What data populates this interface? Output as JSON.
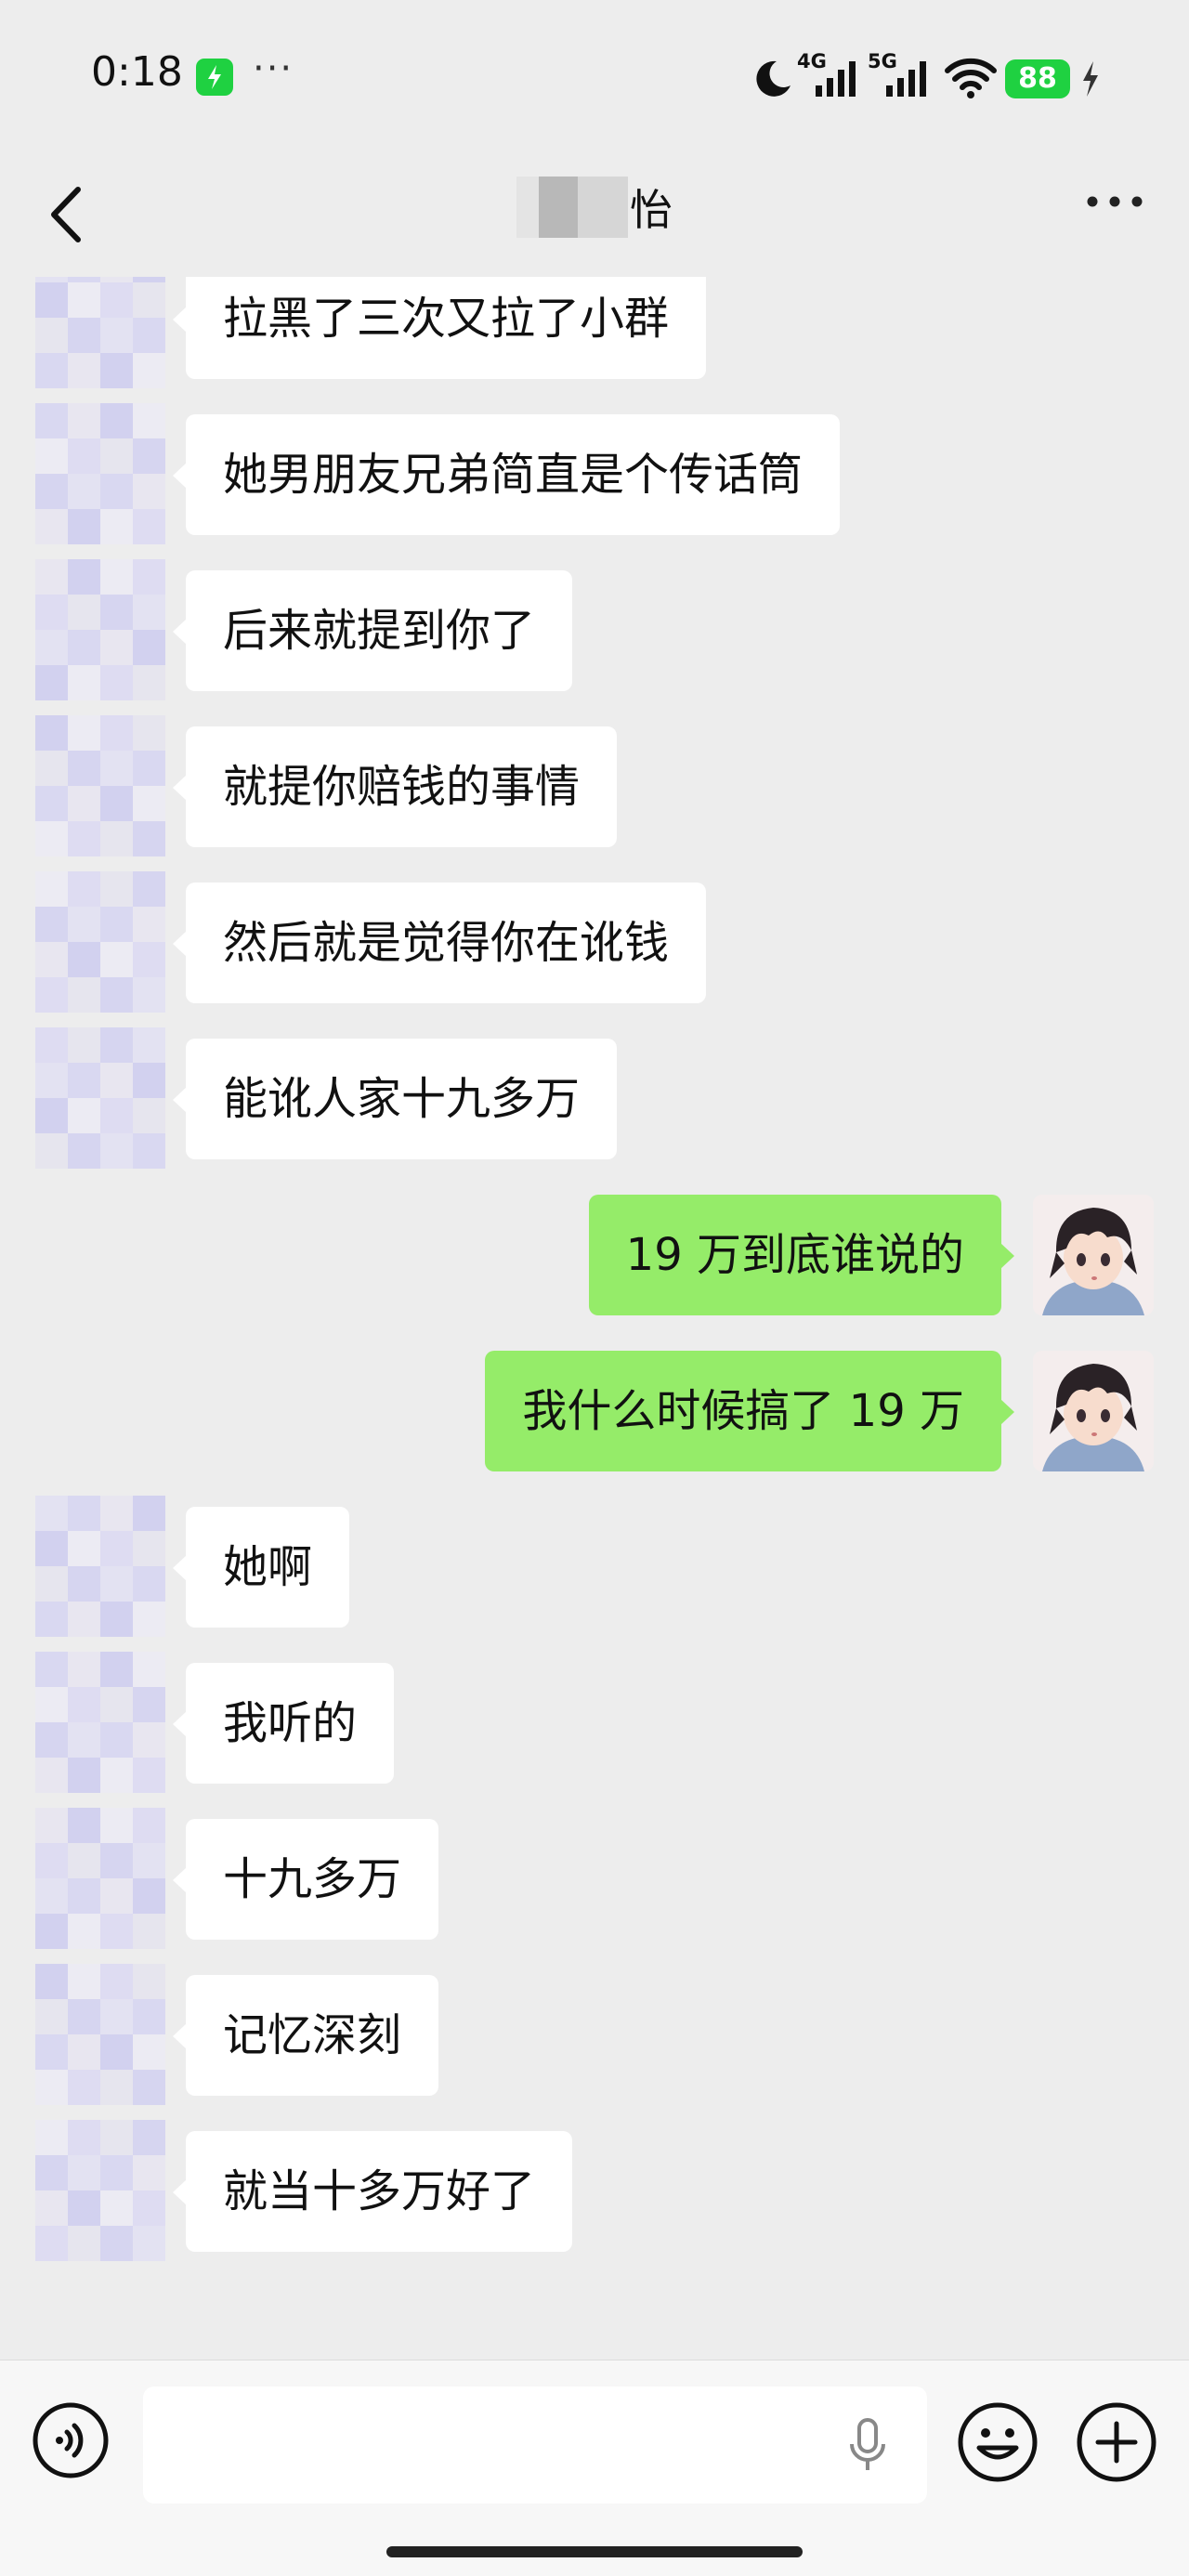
{
  "status_bar": {
    "time": "0:18",
    "more": "···",
    "network_1": "4G",
    "network_2": "5G",
    "battery": "88",
    "icons": [
      "charging-app-icon",
      "moon-icon",
      "signal-icon",
      "wifi-icon",
      "battery-icon",
      "bolt-icon"
    ]
  },
  "header": {
    "title_visible": "怡",
    "more": "···",
    "icons": [
      "back-chevron-icon",
      "more-dots-icon"
    ]
  },
  "messages": [
    {
      "side": "left",
      "text": "拉黑了三次又拉了小群"
    },
    {
      "side": "left",
      "text": "她男朋友兄弟简直是个传话筒"
    },
    {
      "side": "left",
      "text": "后来就提到你了"
    },
    {
      "side": "left",
      "text": "就提你赔钱的事情"
    },
    {
      "side": "left",
      "text": "然后就是觉得你在讹钱"
    },
    {
      "side": "left",
      "text": "能讹人家十九多万"
    },
    {
      "side": "right",
      "text": "19 万到底谁说的"
    },
    {
      "side": "right",
      "text": "我什么时候搞了 19 万"
    },
    {
      "side": "left",
      "text": "她啊"
    },
    {
      "side": "left",
      "text": "我听的"
    },
    {
      "side": "left",
      "text": "十九多万"
    },
    {
      "side": "left",
      "text": "记忆深刻"
    },
    {
      "side": "left",
      "text": "就当十多万好了"
    }
  ],
  "input_bar": {
    "placeholder": "",
    "icons": [
      "voice-icon",
      "mic-icon",
      "emoji-icon",
      "plus-icon"
    ]
  },
  "colors": {
    "background": "#ededed",
    "incoming_bubble": "#ffffff",
    "outgoing_bubble": "#95ec69",
    "status_green": "#1fd141"
  }
}
